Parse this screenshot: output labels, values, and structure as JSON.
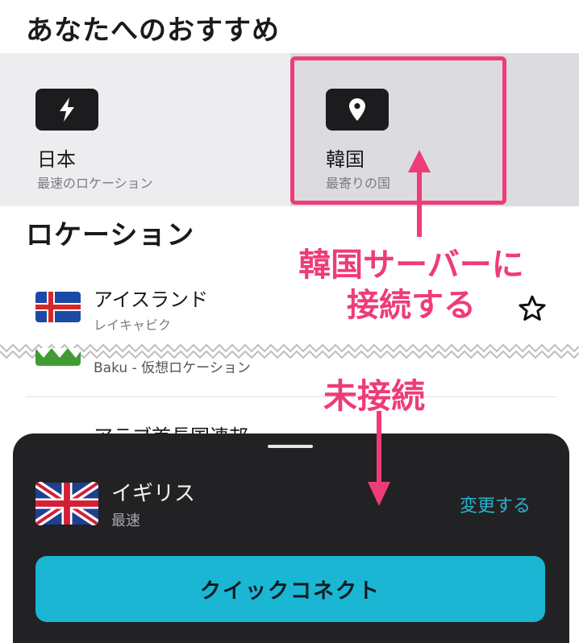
{
  "recommended": {
    "heading": "あなたへのおすすめ",
    "cards": [
      {
        "title": "日本",
        "subtitle": "最速のロケーション",
        "icon": "bolt-icon"
      },
      {
        "title": "韓国",
        "subtitle": "最寄りの国",
        "icon": "location-pin-icon"
      }
    ]
  },
  "locations": {
    "heading": "ロケーション",
    "items": [
      {
        "name": "アイスランド",
        "sub": "レイキャビク",
        "flag": "iceland-flag"
      },
      {
        "name": "Baku - 仮想ロケーション",
        "flag": "azerbaijan-flag"
      },
      {
        "name": "アラブ首長国連邦",
        "flag": "uae-flag"
      }
    ]
  },
  "annotations": {
    "korea_line1": "韓国サーバーに",
    "korea_line2": "接続する",
    "unconnected": "未接続"
  },
  "connection_panel": {
    "country": "イギリス",
    "mode": "最速",
    "change_label": "変更する",
    "quick_connect_label": "クイックコネクト"
  },
  "colors": {
    "accent": "#1ab6d3",
    "annotation": "#ee3c76",
    "panel_bg": "#222224"
  }
}
